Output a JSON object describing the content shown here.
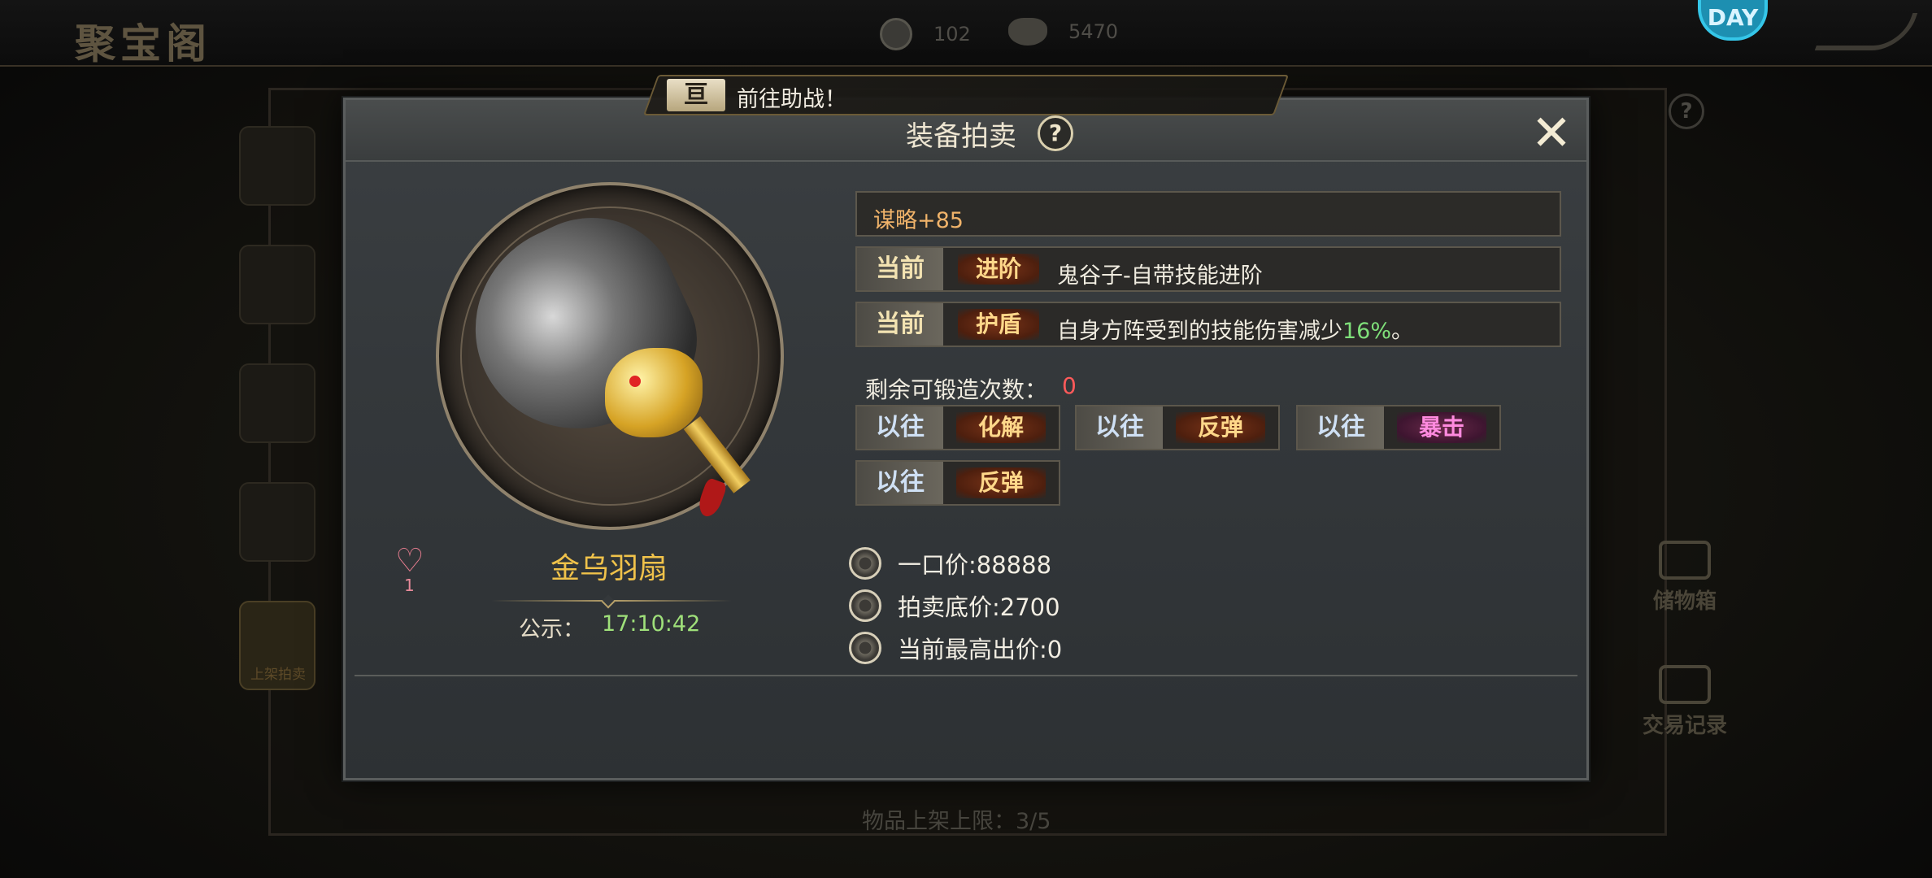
{
  "background": {
    "shop_title": "聚宝阁",
    "currency": [
      {
        "icon": "coin-icon",
        "value": "102"
      },
      {
        "icon": "ingot-icon",
        "value": "5470"
      }
    ],
    "side_tab_label": "上架拍卖",
    "right_buttons": [
      "储物箱",
      "交易记录"
    ],
    "shelf_limit": "物品上架上限：3/5"
  },
  "notice": {
    "icon": "notice-icon",
    "text": "前往助战！"
  },
  "dialog": {
    "title": "装备拍卖",
    "help_label": "?",
    "close_label": "✕",
    "item": {
      "name": "金乌羽扇",
      "favorite_count": "1",
      "public_label": "公示：",
      "public_time": "17:10:42"
    },
    "attributes": {
      "base": "谋略+85",
      "current": [
        {
          "tag": "当前",
          "type": "进阶",
          "desc": "鬼谷子-自带技能进阶",
          "pct": "",
          "suffix": ""
        },
        {
          "tag": "当前",
          "type": "护盾",
          "desc": "自身方阵受到的技能伤害减少",
          "pct": "16%",
          "suffix": "。"
        }
      ],
      "forge_label": "剩余可锻造次数：",
      "forge_remaining": "0",
      "past": [
        {
          "tag": "以往",
          "kind": "化解"
        },
        {
          "tag": "以往",
          "kind": "反弹"
        },
        {
          "tag": "以往",
          "kind": "暴击"
        },
        {
          "tag": "以往",
          "kind": "反弹"
        }
      ]
    },
    "prices": {
      "buyout": "一口价:88888",
      "reserve": "拍卖底价:2700",
      "highest_bid": "当前最高出价:0"
    }
  },
  "colors": {
    "item_name": "#f0c24a",
    "public_time": "#9fe07a",
    "forge_remaining": "#ff5a5a",
    "percent": "#7fe07a",
    "crit_tag": "#ff8adf"
  }
}
